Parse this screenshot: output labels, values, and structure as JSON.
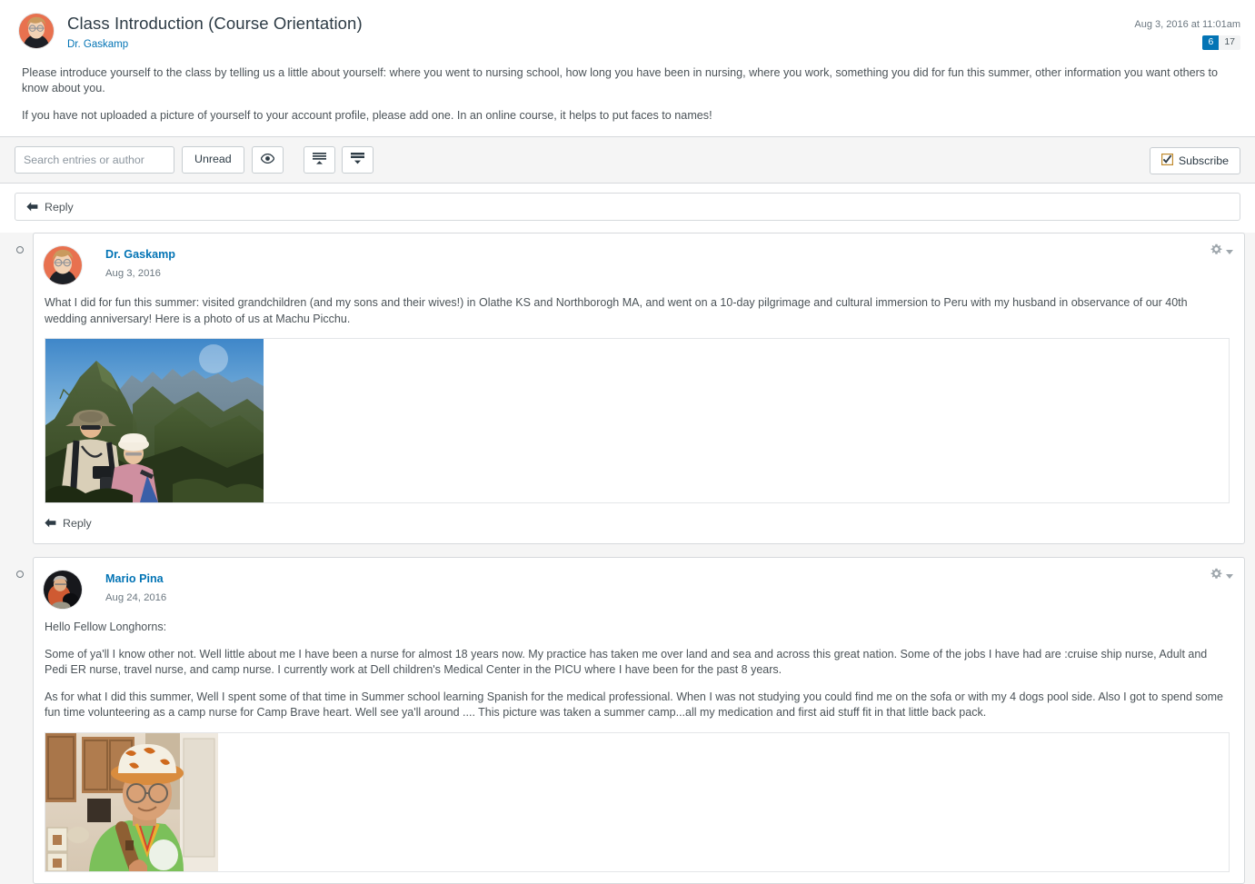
{
  "topic": {
    "title": "Class Introduction (Course Orientation)",
    "author": "Dr. Gaskamp",
    "posted_at": "Aug 3, 2016 at 11:01am",
    "unread_count": "6",
    "total_count": "17",
    "paragraphs": [
      "Please introduce yourself to the class by telling us a little about yourself: where you went to nursing school, how long you have been in nursing, where you work, something you did for fun this summer, other information you want others to know about you.",
      "If you have not uploaded a picture of yourself to your account profile, please add one. In an online course, it helps to put faces to names!"
    ]
  },
  "toolbar": {
    "search_placeholder": "Search entries or author",
    "search_value": "",
    "unread_label": "Unread",
    "eye_icon": "eye-icon",
    "collapse_icon": "collapse-threads-icon",
    "expand_icon": "expand-threads-icon",
    "subscribe_label": "Subscribe",
    "subscribe_icon": "checkbox-checked-icon"
  },
  "reply_bar": {
    "label": "Reply",
    "icon": "reply-arrow-icon"
  },
  "entries": [
    {
      "author": "Dr. Gaskamp",
      "date": "Aug 3, 2016",
      "gear_icon": "gear-icon",
      "avatar": "dr-gaskamp-avatar",
      "paragraphs": [
        "What I did for fun this summer: visited grandchildren (and my sons and their wives!) in Olathe KS and Northborogh MA, and went on a 10-day pilgrimage and cultural immersion to Peru with my husband in observance of our 40th wedding anniversary! Here is a photo of us at Machu Picchu."
      ],
      "photo": "machu-picchu-photo",
      "reply_label": "Reply",
      "unread": true
    },
    {
      "author": "Mario Pina",
      "date": "Aug 24, 2016",
      "gear_icon": "gear-icon",
      "avatar": "mario-pina-avatar",
      "paragraphs": [
        "Hello Fellow Longhorns:",
        "Some of ya'll I know other not. Well little about me I have been a nurse for almost 18 years now.  My practice has taken me over land and sea and across this great nation. Some of the jobs I have had are :cruise ship nurse, Adult and Pedi ER nurse, travel nurse, and camp nurse.  I currently work at Dell children's Medical Center in the PICU where I have been for the past 8 years.",
        "As for what I did this summer, Well I spent some of that time in Summer school learning Spanish for the medical professional. When I was not studying you  could find me on the sofa or with my 4 dogs pool side.  Also I got to spend some fun time volunteering as a camp nurse for Camp Brave heart. Well see ya'll around .... This picture was taken a summer camp...all my medication and first aid stuff fit in that little back pack."
      ],
      "photo": "mario-camp-photo",
      "unread": true
    }
  ],
  "colors": {
    "link": "#0374b5",
    "text": "#4b5358",
    "border": "#d6d9dc",
    "badge_unread_bg": "#0374b5",
    "page_bg": "#f5f5f5"
  }
}
